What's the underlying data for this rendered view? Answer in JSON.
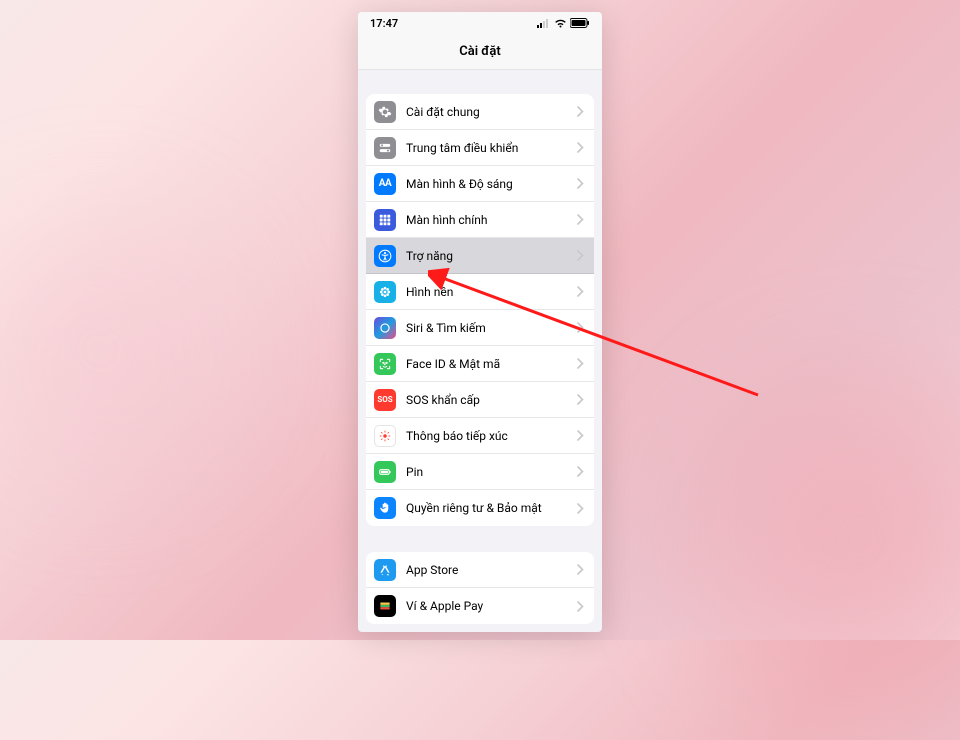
{
  "status_bar": {
    "time": "17:47"
  },
  "nav": {
    "title": "Cài đặt"
  },
  "groups": [
    {
      "rows": [
        {
          "key": "general",
          "label": "Cài đặt chung"
        },
        {
          "key": "control",
          "label": "Trung tâm điều khiển"
        },
        {
          "key": "display",
          "label": "Màn hình & Độ sáng"
        },
        {
          "key": "home",
          "label": "Màn hình chính"
        },
        {
          "key": "access",
          "label": "Trợ năng",
          "highlighted": true
        },
        {
          "key": "wallpaper",
          "label": "Hình nền"
        },
        {
          "key": "siri",
          "label": "Siri & Tìm kiếm"
        },
        {
          "key": "faceid",
          "label": "Face ID & Mật mã"
        },
        {
          "key": "sos",
          "label": "SOS khẩn cấp",
          "icon_text": "SOS"
        },
        {
          "key": "exposure",
          "label": "Thông báo tiếp xúc"
        },
        {
          "key": "battery",
          "label": "Pin"
        },
        {
          "key": "privacy",
          "label": "Quyền riêng tư & Bảo mật"
        }
      ]
    },
    {
      "rows": [
        {
          "key": "appstore",
          "label": "App Store"
        },
        {
          "key": "wallet",
          "label": "Ví & Apple Pay"
        }
      ]
    }
  ]
}
